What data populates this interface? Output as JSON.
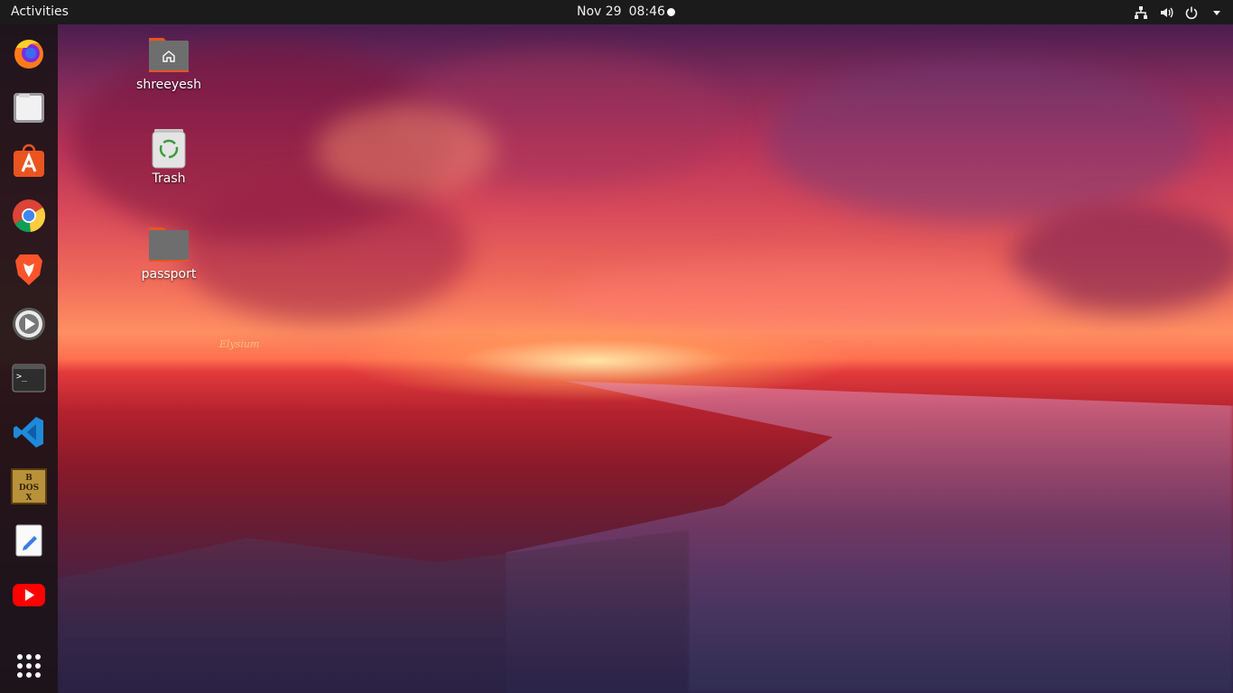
{
  "topbar": {
    "activities_label": "Activities",
    "date": "Nov 29",
    "time": "08:46",
    "tray_icons": [
      "network-icon",
      "volume-icon",
      "power-icon",
      "chevron-down-icon"
    ]
  },
  "dock": {
    "items": [
      {
        "name": "Firefox",
        "icon": "firefox-icon"
      },
      {
        "name": "Files",
        "icon": "files-icon"
      },
      {
        "name": "Ubuntu Software",
        "icon": "software-store-icon"
      },
      {
        "name": "Google Chrome",
        "icon": "chrome-icon"
      },
      {
        "name": "Brave",
        "icon": "brave-icon"
      },
      {
        "name": "Videos",
        "icon": "videos-icon"
      },
      {
        "name": "Terminal",
        "icon": "terminal-icon"
      },
      {
        "name": "Visual Studio Code",
        "icon": "vscode-icon"
      },
      {
        "name": "DOSBox",
        "icon": "dosbox-icon"
      },
      {
        "name": "Text Editor",
        "icon": "text-editor-icon"
      },
      {
        "name": "YouTube",
        "icon": "youtube-icon"
      },
      {
        "name": "Show Applications",
        "icon": "app-grid-icon"
      }
    ],
    "dosbox_text": [
      "B",
      "DOS",
      "X"
    ],
    "terminal_prompt": ">_"
  },
  "desktop": {
    "icons": [
      {
        "label": "shreeyesh",
        "type": "home-folder"
      },
      {
        "label": "Trash",
        "type": "trash"
      },
      {
        "label": "passport",
        "type": "folder"
      }
    ],
    "wallpaper_watermark": "Elysium"
  },
  "colors": {
    "topbar_bg": "#1b1b1b",
    "dock_bg": "#1c1418",
    "folder_body": "#6e6e6e",
    "folder_tab": "#e95420"
  }
}
